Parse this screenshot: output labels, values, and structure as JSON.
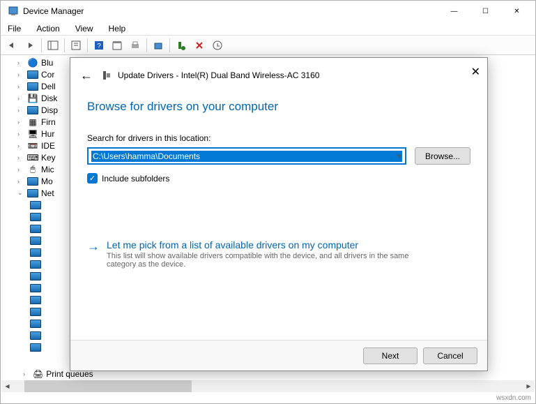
{
  "window": {
    "title": "Device Manager",
    "controls": {
      "min": "—",
      "max": "☐",
      "close": "✕"
    }
  },
  "menu": {
    "file": "File",
    "action": "Action",
    "view": "View",
    "help": "Help"
  },
  "tree": {
    "items": [
      {
        "label": "Blu",
        "collapsed": true
      },
      {
        "label": "Cor",
        "collapsed": true
      },
      {
        "label": "Dell",
        "collapsed": true
      },
      {
        "label": "Disk",
        "collapsed": true
      },
      {
        "label": "Disp",
        "collapsed": true
      },
      {
        "label": "Firn",
        "collapsed": true
      },
      {
        "label": "Hur",
        "collapsed": true
      },
      {
        "label": "IDE",
        "collapsed": true
      },
      {
        "label": "Key",
        "collapsed": true
      },
      {
        "label": "Mic",
        "collapsed": true
      },
      {
        "label": "Mo",
        "collapsed": true
      },
      {
        "label": "Net",
        "collapsed": false
      }
    ],
    "bottom_item": "Print queues"
  },
  "dialog": {
    "title_prefix": "Update Drivers - ",
    "device": "Intel(R) Dual Band Wireless-AC 3160",
    "heading": "Browse for drivers on your computer",
    "search_label": "Search for drivers in this location:",
    "path_value": "C:\\Users\\hamma\\Documents",
    "browse_btn": "Browse...",
    "include_subfolders": "Include subfolders",
    "pick_title": "Let me pick from a list of available drivers on my computer",
    "pick_desc": "This list will show available drivers compatible with the device, and all drivers in the same category as the device.",
    "next_btn": "Next",
    "cancel_btn": "Cancel"
  },
  "watermark": "wsxdn.com"
}
